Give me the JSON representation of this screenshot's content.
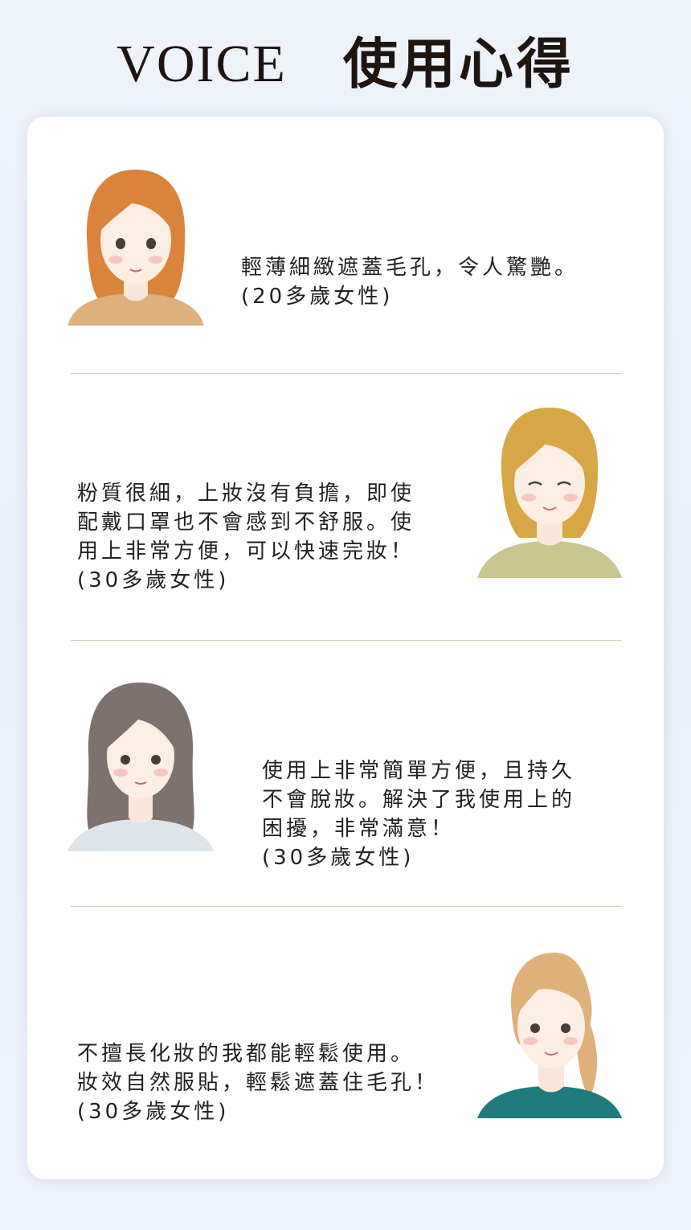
{
  "header": {
    "title_en": "VOICE",
    "title_zh": "使用心得"
  },
  "testimonials": [
    {
      "avatar": "woman-orange-hair-avatar",
      "text": "輕薄細緻遮蓋毛孔，令人驚艷。",
      "age": "(20多歲女性)"
    },
    {
      "avatar": "woman-blonde-bob-avatar",
      "text": "粉質很細，上妝沒有負擔，即使\n配戴口罩也不會感到不舒服。使\n用上非常方便，可以快速完妝！",
      "age": "(30多歲女性)"
    },
    {
      "avatar": "woman-long-gray-hair-avatar",
      "text": "使用上非常簡單方便，且持久\n不會脫妝。解決了我使用上的\n困擾，非常滿意！",
      "age": "(30多歲女性)"
    },
    {
      "avatar": "woman-ponytail-avatar",
      "text": "不擅長化妝的我都能輕鬆使用。\n妝效自然服貼，輕鬆遮蓋住毛孔！",
      "age": "(30多歲女性)"
    }
  ],
  "colors": {
    "divider": "#d9c9b6",
    "hair_1": "#d9843a",
    "hair_2": "#d6a744",
    "hair_3": "#7d726e",
    "hair_4": "#dfb07a",
    "shirt_1": "#deb07e",
    "shirt_2": "#c9c690",
    "shirt_3": "#dfe3ea",
    "shirt_4": "#1f7b7e"
  }
}
